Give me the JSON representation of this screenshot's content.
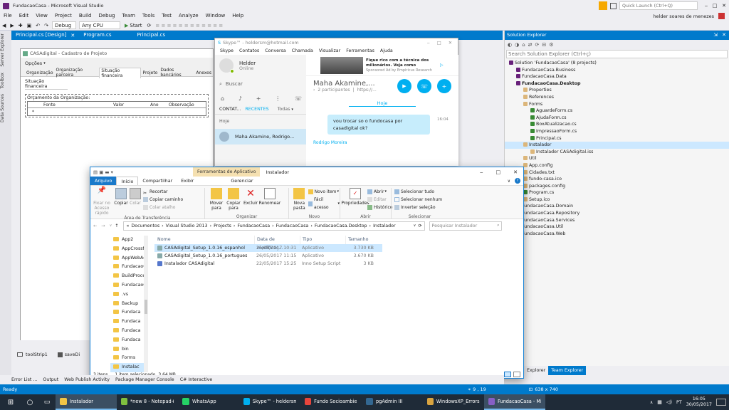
{
  "vs": {
    "title": "FundacaoCasa - Microsoft Visual Studio",
    "quick_launch_placeholder": "Quick Launch (Ctrl+Q)",
    "user_name": "helder soares de menezes",
    "menu": [
      "File",
      "Edit",
      "View",
      "Project",
      "Build",
      "Debug",
      "Team",
      "Tools",
      "Test",
      "Analyze",
      "Window",
      "Help"
    ],
    "config": "Debug",
    "platform": "Any CPU",
    "start_label": "Start",
    "doc_tabs": [
      "Principal.cs [Design]",
      "Program.cs",
      "Principal.cs"
    ],
    "left_strip": [
      "Server Explorer",
      "Toolbox",
      "Data Sources"
    ],
    "form_title": "CASAdigital - Cadastro de Projeto",
    "opcoes": "Opções",
    "form_tabs": [
      "Organização",
      "Organização parceira",
      "Situação financeira",
      "Projeto",
      "Dados bancários",
      "Anexos"
    ],
    "group_situacao": "Situação financeira",
    "group_orcamento": "Orçamento da Organização:",
    "grid_columns": [
      "Fonte",
      "Valor",
      "Ano",
      "Observação"
    ],
    "grid_row_marker": "*",
    "component_tray": [
      "toolStrip1",
      "saveDi"
    ],
    "bottom_tabs": [
      "Error List ...",
      "Output",
      "Web Publish Activity",
      "Package Manager Console",
      "C# Interactive"
    ],
    "status": "Ready",
    "cursor_pos": "9 , 19",
    "size_readout": "638 x 740"
  },
  "solution_explorer": {
    "title": "Solution Explorer",
    "search_placeholder": "Search Solution Explorer (Ctrl+ç)",
    "items": [
      {
        "label": "Solution 'FundacaoCasa' (8 projects)",
        "indent": 0
      },
      {
        "label": "FundacaoCasa.Business",
        "indent": 1
      },
      {
        "label": "FundacaoCasa.Data",
        "indent": 1
      },
      {
        "label": "FundacaoCasa.Desktop",
        "indent": 1,
        "bold": true
      },
      {
        "label": "Properties",
        "indent": 2
      },
      {
        "label": "References",
        "indent": 2
      },
      {
        "label": "Forms",
        "indent": 2
      },
      {
        "label": "AguardeForm.cs",
        "indent": 3
      },
      {
        "label": "AjudaForm.cs",
        "indent": 3
      },
      {
        "label": "BoxAtualizacao.cs",
        "indent": 3
      },
      {
        "label": "ImpressaoForm.cs",
        "indent": 3
      },
      {
        "label": "Principal.cs",
        "indent": 3
      },
      {
        "label": "Instalador",
        "indent": 2,
        "selected": true
      },
      {
        "label": "Instalador CASAdigital.iss",
        "indent": 3
      },
      {
        "label": "Util",
        "indent": 2
      },
      {
        "label": "App.config",
        "indent": 2
      },
      {
        "label": "Cidades.txt",
        "indent": 2
      },
      {
        "label": "fundo-casa.ico",
        "indent": 2
      },
      {
        "label": "packages.config",
        "indent": 2
      },
      {
        "label": "Program.cs",
        "indent": 2
      },
      {
        "label": "Setup.ico",
        "indent": 2
      },
      {
        "label": "FundacaoCasa.Domain",
        "indent": 1
      },
      {
        "label": "FundacaoCasa.Repository",
        "indent": 1
      },
      {
        "label": "FundacaoCasa.Services",
        "indent": 1
      },
      {
        "label": "FundacaoCasa.Util",
        "indent": 1
      },
      {
        "label": "FundacaoCasa.Web",
        "indent": 1
      }
    ],
    "bottom_tabs": [
      "Explorer",
      "Team Explorer"
    ]
  },
  "skype": {
    "title": "Skype™ - heldersm@hotmail.com",
    "menu": [
      "Skype",
      "Contatos",
      "Conversa",
      "Chamada",
      "Visualizar",
      "Ferramentas",
      "Ajuda"
    ],
    "user_name": "Helder",
    "user_status": "Online",
    "search_placeholder": "Buscar",
    "ad_text": "Fique rico com a técnica dos milionários. Veja como",
    "ad_sponsor": "Sponsored Ad by Empiricus Research",
    "tabs": [
      "CONTAT...",
      "RECENTES",
      "Todas"
    ],
    "today": "Hoje",
    "recent_contact": "Maha Akamine, Rodrigo...",
    "chat_title": "Maha Akamine,...",
    "participants": "2 participantes",
    "link": "https://...",
    "chat_today": "Hoje",
    "message": "vou trocar so o fundocasa por casadigital ok?",
    "message_time": "16:04",
    "next_sender": "Rodrigo Moreira"
  },
  "explorer": {
    "context_tab": "Ferramentas de Aplicativo",
    "window_title": "Instalador",
    "tabs": [
      "Arquivo",
      "Início",
      "Compartilhar",
      "Exibir",
      "Gerenciar"
    ],
    "clipboard": {
      "pin": "Fixar no Acesso rápido",
      "copy": "Copiar",
      "paste": "Colar",
      "cut": "Recortar",
      "copy_path": "Copiar caminho",
      "paste_shortcut": "Colar atalho",
      "label": "Área de Transferência"
    },
    "organize": {
      "move": "Mover para",
      "copy": "Copiar para",
      "delete": "Excluir",
      "rename": "Renomear",
      "label": "Organizar"
    },
    "new": {
      "new_folder": "Nova pasta",
      "new_item": "Novo item",
      "easy_access": "Fácil acesso",
      "label": "Novo"
    },
    "open": {
      "properties": "Propriedades",
      "open": "Abrir",
      "edit": "Editar",
      "history": "Histórico",
      "label": "Abrir"
    },
    "select": {
      "all": "Selecionar tudo",
      "none": "Selecionar nenhum",
      "invert": "Inverter seleção",
      "label": "Selecionar"
    },
    "breadcrumb": [
      "Documentos",
      "Visual Studio 2013",
      "Projects",
      "FundacaoCasa",
      "FundacaoCasa",
      "FundacaoCasa.Desktop",
      "Instalador"
    ],
    "search_placeholder": "Pesquisar Instalador",
    "nav": [
      "App2",
      "AppCrossfit",
      "AppWebAc...",
      "FundacaoC...",
      "BuildProce...",
      "FundacaoC...",
      ".vs",
      "Backup",
      "Fundaca",
      "Fundaca",
      "Fundaca",
      "Fundaca",
      "bin",
      "Forms",
      "Instalac"
    ],
    "columns": [
      "Nome",
      "Data de modificaç...",
      "Tipo",
      "Tamanho"
    ],
    "files": [
      {
        "name": "CASAdigital_Setup_1.0.16_espanhol",
        "date": "25/05/2017 10:31",
        "type": "Aplicativo",
        "size": "3.730 KB",
        "selected": true
      },
      {
        "name": "CASAdigital_Setup_1.0.16_portugues",
        "date": "26/05/2017 11:15",
        "type": "Aplicativo",
        "size": "3.670 KB",
        "selected": false
      },
      {
        "name": "Instalador CASAdigital",
        "date": "22/05/2017 15:25",
        "type": "Inno Setup Script",
        "size": "3 KB",
        "selected": false
      }
    ],
    "status_count": "3 itens",
    "status_selected": "1 item selecionado",
    "status_size": "3,64 MB"
  },
  "taskbar": {
    "items": [
      {
        "label": "Instalador",
        "color": "#f3c545",
        "active": true
      },
      {
        "label": "*new 8 - Notepad++",
        "color": "#7fbf3f",
        "active": false
      },
      {
        "label": "WhatsApp",
        "color": "#25d366",
        "active": false
      },
      {
        "label": "Skype™ - heldersm...",
        "color": "#00aff0",
        "active": false
      },
      {
        "label": "Fundo Socioambie...",
        "color": "#e8453c",
        "active": false
      },
      {
        "label": "pgAdmin III",
        "color": "#336791",
        "active": false
      },
      {
        "label": "WindowsXP_Errors ...",
        "color": "#d9a440",
        "active": false
      },
      {
        "label": "FundacaoCasa - Mi...",
        "color": "#865fc5",
        "active": true
      }
    ],
    "lang": "PT",
    "time": "16:05",
    "date": "30/05/2017"
  },
  "colors": {
    "vs_blue": "#007acc",
    "taskbar": "#1f2b38",
    "skype_blue": "#00aff0",
    "selection": "#cce8ff"
  }
}
